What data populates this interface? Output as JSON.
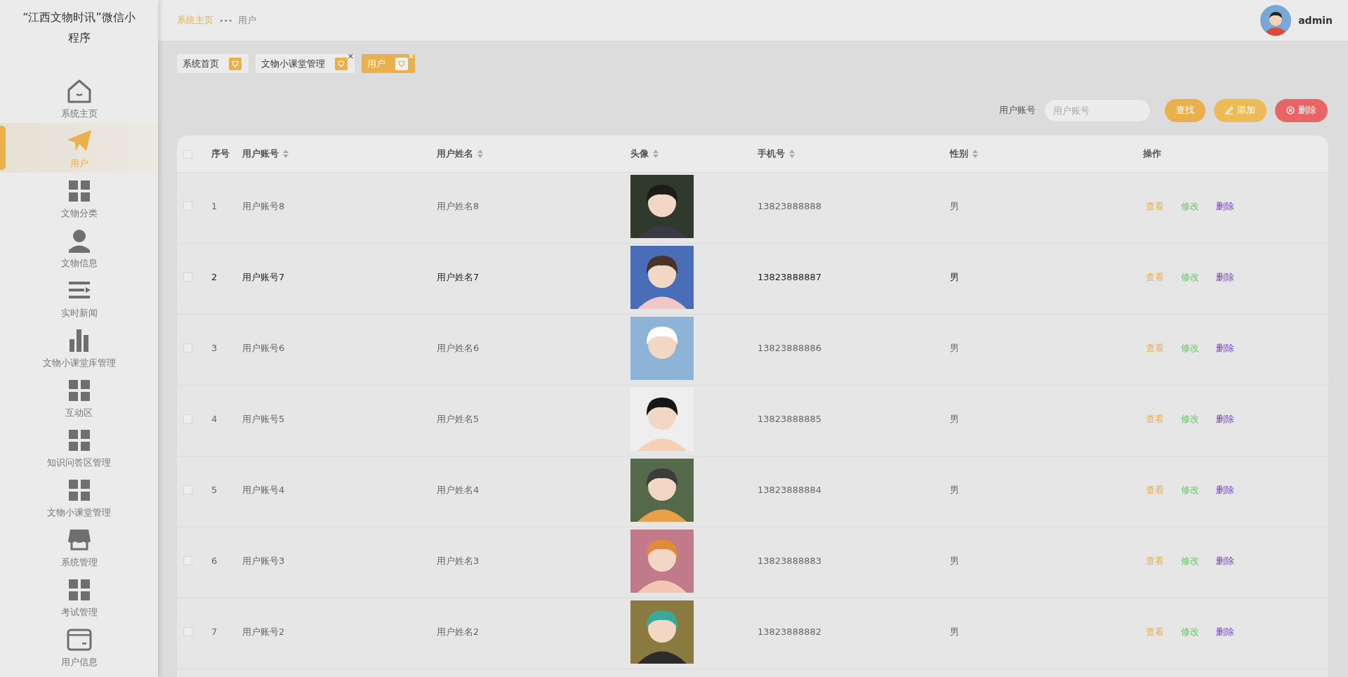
{
  "app_title": "“江西文物时讯”微信小程序",
  "sidebar": {
    "items": [
      {
        "label": "系统主页",
        "selected": false
      },
      {
        "label": "用户",
        "selected": true
      },
      {
        "label": "文物分类",
        "selected": false
      },
      {
        "label": "文物信息",
        "selected": false
      },
      {
        "label": "实时新闻",
        "selected": false
      },
      {
        "label": "文物小课堂库管理",
        "selected": false
      },
      {
        "label": "互动区",
        "selected": false
      },
      {
        "label": "知识问答区管理",
        "selected": false
      },
      {
        "label": "文物小课堂管理",
        "selected": false
      },
      {
        "label": "系统管理",
        "selected": false
      },
      {
        "label": "考试管理",
        "selected": false
      },
      {
        "label": "用户信息",
        "selected": false
      }
    ]
  },
  "breadcrumb": [
    {
      "label": "系统主页",
      "selected": false
    },
    {
      "label": "用户",
      "selected": true
    }
  ],
  "breadcrumb_separator": "•••",
  "user": {
    "name": "admin"
  },
  "tabs": [
    {
      "label": "系统首页",
      "selected": false
    },
    {
      "label": "文物小课堂管理",
      "selected": false,
      "close": "✕"
    },
    {
      "label": "用户",
      "selected": true,
      "close": "✕"
    }
  ],
  "search": {
    "label": "用户账号",
    "placeholder": "用户账号"
  },
  "buttons": [
    {
      "label": "查找",
      "kind": "search"
    },
    {
      "label": "添加",
      "kind": "add"
    },
    {
      "label": "删除",
      "kind": "delete"
    }
  ],
  "table": {
    "all_checked": false,
    "columns": [
      {
        "label": "序号",
        "sortable": false
      },
      {
        "label": "用户账号",
        "sortable": true
      },
      {
        "label": "用户姓名",
        "sortable": true
      },
      {
        "label": "头像",
        "sortable": true
      },
      {
        "label": "手机号",
        "sortable": true
      },
      {
        "label": "性别",
        "sortable": true
      },
      {
        "label": "操作",
        "sortable": false
      }
    ],
    "rows": [
      {
        "checked": false,
        "index": "1",
        "account": "用户账号8",
        "name": "用户姓名8",
        "phone": "13823888888",
        "gender": "男",
        "highlighted": false,
        "actions": [
          {
            "label": "查看",
            "kind": "view"
          },
          {
            "label": "修改",
            "kind": "edit"
          },
          {
            "label": "删除",
            "kind": "delete"
          }
        ]
      },
      {
        "checked": false,
        "index": "2",
        "account": "用户账号7",
        "name": "用户姓名7",
        "phone": "13823888887",
        "gender": "男",
        "highlighted": true,
        "actions": [
          {
            "label": "查看",
            "kind": "view"
          },
          {
            "label": "修改",
            "kind": "edit"
          },
          {
            "label": "删除",
            "kind": "delete"
          }
        ]
      },
      {
        "checked": false,
        "index": "3",
        "account": "用户账号6",
        "name": "用户姓名6",
        "phone": "13823888886",
        "gender": "男",
        "highlighted": false,
        "actions": [
          {
            "label": "查看",
            "kind": "view"
          },
          {
            "label": "修改",
            "kind": "edit"
          },
          {
            "label": "删除",
            "kind": "delete"
          }
        ]
      },
      {
        "checked": false,
        "index": "4",
        "account": "用户账号5",
        "name": "用户姓名5",
        "phone": "13823888885",
        "gender": "男",
        "highlighted": false,
        "actions": [
          {
            "label": "查看",
            "kind": "view"
          },
          {
            "label": "修改",
            "kind": "edit"
          },
          {
            "label": "删除",
            "kind": "delete"
          }
        ]
      },
      {
        "checked": false,
        "index": "5",
        "account": "用户账号4",
        "name": "用户姓名4",
        "phone": "13823888884",
        "gender": "男",
        "highlighted": false,
        "actions": [
          {
            "label": "查看",
            "kind": "view"
          },
          {
            "label": "修改",
            "kind": "edit"
          },
          {
            "label": "删除",
            "kind": "delete"
          }
        ]
      },
      {
        "checked": false,
        "index": "6",
        "account": "用户账号3",
        "name": "用户姓名3",
        "phone": "13823888883",
        "gender": "男",
        "highlighted": false,
        "actions": [
          {
            "label": "查看",
            "kind": "view"
          },
          {
            "label": "修改",
            "kind": "edit"
          },
          {
            "label": "删除",
            "kind": "delete"
          }
        ]
      },
      {
        "checked": false,
        "index": "7",
        "account": "用户账号2",
        "name": "用户姓名2",
        "phone": "13823888882",
        "gender": "男",
        "highlighted": false,
        "actions": [
          {
            "label": "查看",
            "kind": "view"
          },
          {
            "label": "修改",
            "kind": "edit"
          },
          {
            "label": "删除",
            "kind": "delete"
          }
        ]
      }
    ]
  }
}
